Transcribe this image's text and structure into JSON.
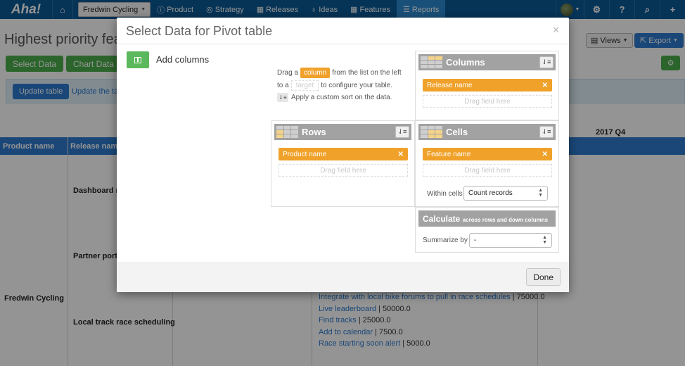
{
  "nav": {
    "logo": "Aha!",
    "product_select": "Fredwin Cycling",
    "items": [
      {
        "icon": "info-icon",
        "glyph": "ⓘ",
        "label": "Product"
      },
      {
        "icon": "strategy-icon",
        "glyph": "◎",
        "label": "Strategy"
      },
      {
        "icon": "calendar-icon",
        "glyph": "▦",
        "label": "Releases"
      },
      {
        "icon": "lightbulb-icon",
        "glyph": "♁",
        "label": "Ideas"
      },
      {
        "icon": "features-icon",
        "glyph": "▦",
        "label": "Features"
      },
      {
        "icon": "reports-icon",
        "glyph": "☰",
        "label": "Reports"
      }
    ],
    "active": "Reports"
  },
  "page": {
    "title": "Highest priority featu",
    "select_data_button": "Select Data",
    "chart_data_button": "Chart Data >",
    "views_button": "Views",
    "export_button": "Export",
    "update_table_button": "Update table",
    "update_table_text": "Update the tab"
  },
  "table": {
    "headers": [
      "Product name",
      "Release name"
    ],
    "quarter_header": "2017 Q4",
    "product": "Fredwin Cycling",
    "releases": [
      "Dashboard re",
      "Partner porta",
      "Local track race scheduling"
    ],
    "features": [
      {
        "name": "Integrate with local bike forums to pull in race schedules",
        "value": "75000.0"
      },
      {
        "name": "Live leaderboard",
        "value": "50000.0"
      },
      {
        "name": "Find tracks",
        "value": "25000.0"
      },
      {
        "name": "Add to calendar",
        "value": "7500.0"
      },
      {
        "name": "Race starting soon alert",
        "value": "5000.0"
      }
    ]
  },
  "modal": {
    "title": "Select Data for Pivot table",
    "add_columns_label": "Add columns",
    "instructions": {
      "line1_pre": "Drag a",
      "line1_pill": "column",
      "line1_post": "from the list on the left",
      "line2_pre": "to a",
      "line2_pill": "target",
      "line2_post": "to configure your table.",
      "line3": "Apply a custom sort on the data."
    },
    "columns_zone": {
      "title": "Columns",
      "chip": "Release name",
      "drop": "Drag field here"
    },
    "rows_zone": {
      "title": "Rows",
      "chip": "Product name",
      "drop": "Drag field here"
    },
    "cells_zone": {
      "title": "Cells",
      "chip": "Feature name",
      "drop": "Drag field here",
      "within_label": "Within cells",
      "within_value": "Count records"
    },
    "calculate_zone": {
      "title": "Calculate",
      "subtitle": "across rows and down columns",
      "summarize_label": "Summarize by",
      "summarize_value": "-"
    },
    "done_button": "Done"
  }
}
